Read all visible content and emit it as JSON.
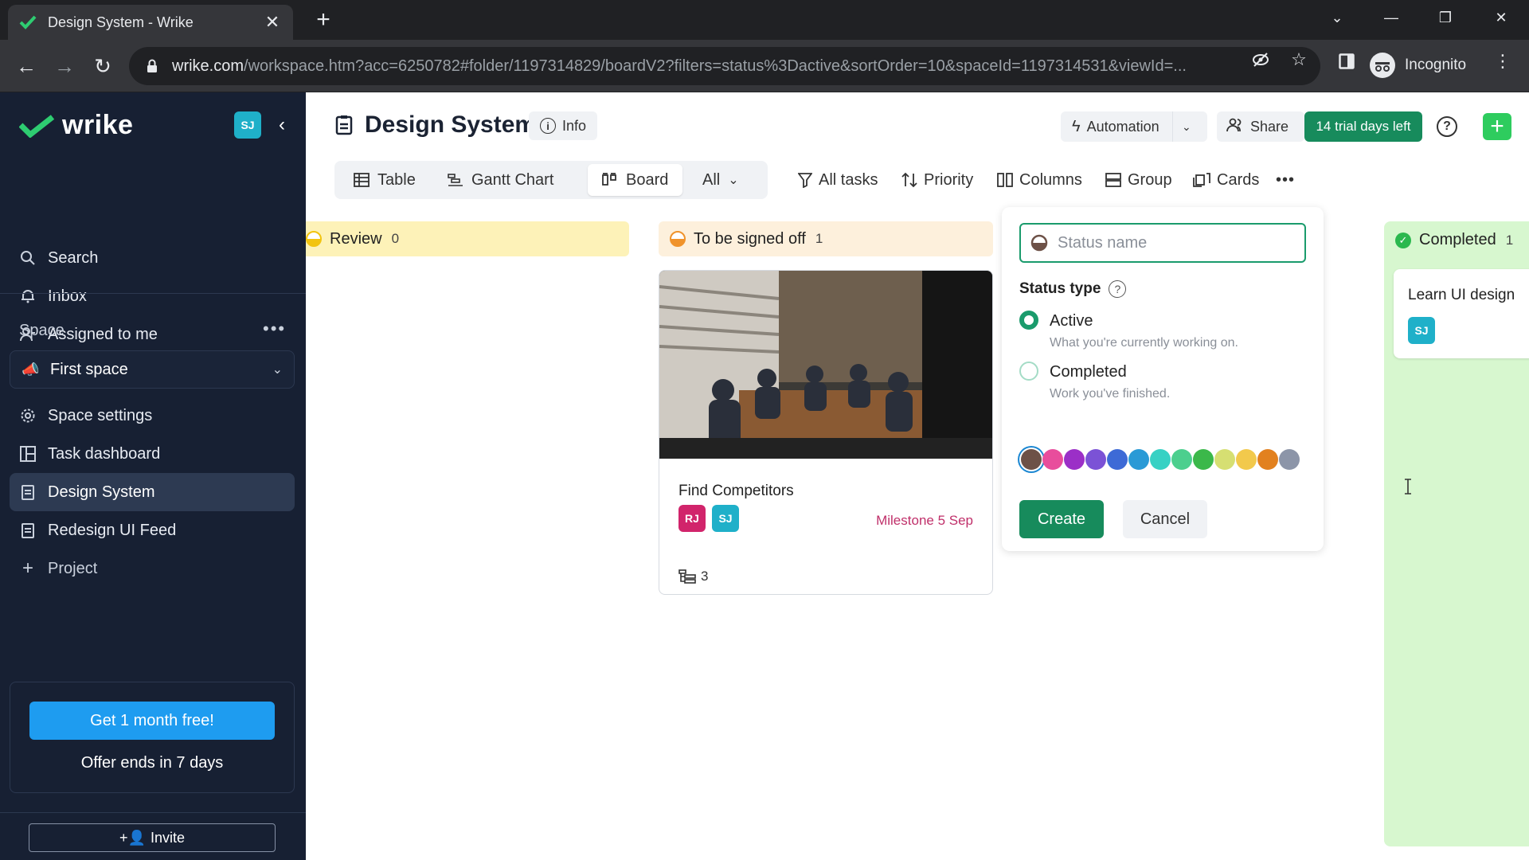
{
  "browser": {
    "tab_title": "Design System - Wrike",
    "url_host": "wrike.com",
    "url_path": "/workspace.htm?acc=6250782#folder/1197314829/boardV2?filters=status%3Dactive&sortOrder=10&spaceId=1197314531&viewId=...",
    "profile_label": "Incognito"
  },
  "sidebar": {
    "logo_text": "wrike",
    "user_initials": "SJ",
    "nav": [
      {
        "label": "Search",
        "icon": "search-icon"
      },
      {
        "label": "Inbox",
        "icon": "bell-icon"
      },
      {
        "label": "Assigned to me",
        "icon": "user-icon"
      }
    ],
    "space_section_label": "Space",
    "space_more": "•••",
    "space_select": "First space",
    "space_items": [
      {
        "label": "Space settings",
        "icon": "gear-icon"
      },
      {
        "label": "Task dashboard",
        "icon": "dashboard-icon"
      },
      {
        "label": "Design System",
        "icon": "document-icon",
        "active": true
      },
      {
        "label": "Redesign UI Feed",
        "icon": "document-icon"
      },
      {
        "label": "Project",
        "icon": "plus-icon"
      }
    ],
    "promo_button": "Get 1 month free!",
    "promo_text": "Offer ends in 7 days",
    "invite_label": "Invite"
  },
  "header": {
    "title": "Design System",
    "info_label": "Info",
    "automation_label": "Automation",
    "share_label": "Share",
    "trial_label": "14 trial days left",
    "accent_color": "#178b5c"
  },
  "views": {
    "tabs": [
      {
        "label": "Table",
        "icon": "table-icon"
      },
      {
        "label": "Gantt Chart",
        "icon": "gantt-icon"
      },
      {
        "label": "Board",
        "icon": "board-icon",
        "active": true
      }
    ],
    "filter_select": "All"
  },
  "toolbar": {
    "all_tasks": "All tasks",
    "priority": "Priority",
    "columns": "Columns",
    "group": "Group",
    "cards": "Cards",
    "more": "•••"
  },
  "board": {
    "columns": [
      {
        "name": "Review",
        "count": "0",
        "color": "#f2c40f",
        "bg": "#fdf2b8"
      },
      {
        "name": "To be signed off",
        "count": "1",
        "color": "#f0932b",
        "bg": "#fdf0dc"
      },
      {
        "name": "Completed",
        "count": "1",
        "color": "#2bb84e",
        "bg": "#d7f7cf"
      }
    ],
    "card": {
      "title": "Find Competitors",
      "assignees": [
        {
          "initials": "RJ",
          "color": "#d1246b"
        },
        {
          "initials": "SJ",
          "color": "#1fb0c9"
        }
      ],
      "milestone": "Milestone 5 Sep",
      "subtask_count": "3"
    },
    "completed_card": {
      "title": "Learn UI design",
      "assignee": "SJ"
    }
  },
  "new_status": {
    "placeholder": "Status name",
    "value": "",
    "type_label": "Status type",
    "options": [
      {
        "title": "Active",
        "subtitle": "What you're currently working on.",
        "selected": true
      },
      {
        "title": "Completed",
        "subtitle": "Work you've finished.",
        "selected": false
      }
    ],
    "colors": [
      "#6d5147",
      "#e84d9c",
      "#9b2fc7",
      "#7b52d6",
      "#3d6ad6",
      "#2a9ad6",
      "#37d1c4",
      "#4ccf8e",
      "#3bb84a",
      "#d6df72",
      "#f2c94c",
      "#e2811f",
      "#8c95a8"
    ],
    "selected_color_index": 0,
    "create_label": "Create",
    "cancel_label": "Cancel"
  }
}
